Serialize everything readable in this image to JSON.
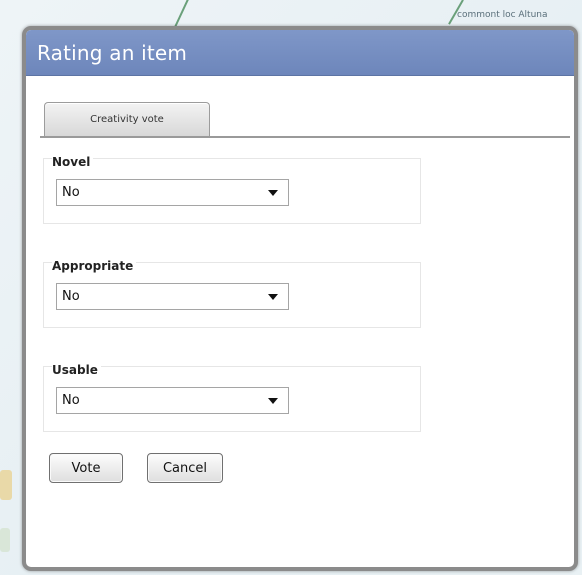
{
  "map": {
    "label_fragment": "commont loc Altuna"
  },
  "dialog": {
    "title": "Rating an item",
    "tab_label": "Creativity vote",
    "fields": [
      {
        "label": "Novel",
        "value": "No"
      },
      {
        "label": "Appropriate",
        "value": "No"
      },
      {
        "label": "Usable",
        "value": "No"
      }
    ],
    "buttons": {
      "vote": "Vote",
      "cancel": "Cancel"
    }
  }
}
